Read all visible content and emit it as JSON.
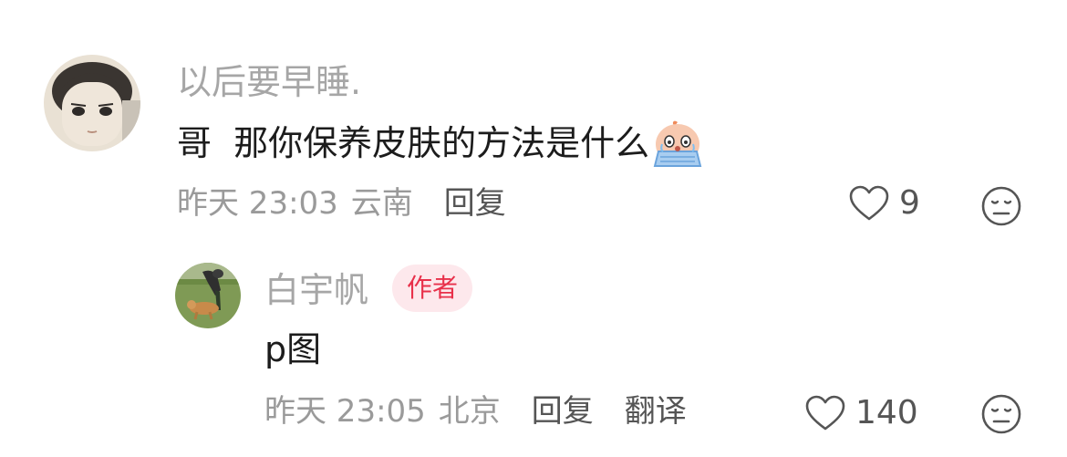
{
  "comments": [
    {
      "username": "以后要早睡.",
      "text": "哥  那你保养皮肤的方法是什么",
      "emoji": "crying-emoji",
      "time": "昨天 23:03",
      "location": "云南",
      "reply_label": "回复",
      "likes": "9"
    },
    {
      "username": "白宇帆",
      "badge": "作者",
      "text": "p图",
      "time": "昨天 23:05",
      "location": "北京",
      "reply_label": "回复",
      "translate_label": "翻译",
      "likes": "140"
    }
  ],
  "icons": {
    "like": "heart-outline-icon",
    "dislike": "meh-face-icon"
  },
  "colors": {
    "username": "#a6a6a6",
    "text": "#1c1c1c",
    "badge_bg": "#fde8ec",
    "badge_text": "#e8304a"
  }
}
